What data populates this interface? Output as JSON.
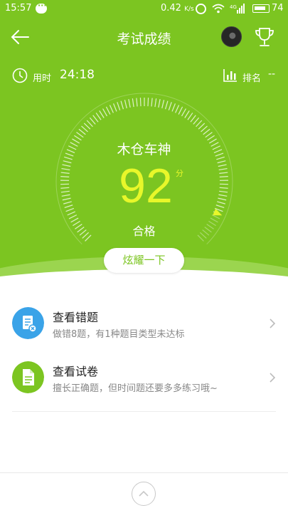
{
  "status_bar": {
    "time": "15:57",
    "network_speed": "0.42",
    "network_unit": "K/s",
    "battery": "74",
    "icons": [
      "message-icon",
      "alarm-icon",
      "wifi-icon",
      "signal-icon",
      "battery-icon"
    ]
  },
  "header": {
    "title": "考试成绩",
    "back_icon": "arrow-left-icon",
    "trophy_icon": "trophy-icon"
  },
  "info": {
    "time_used_label": "用时",
    "time_used_value": "24:18",
    "rank_label": "排名",
    "rank_value": "--"
  },
  "result": {
    "nickname": "木仓车神",
    "score": "92",
    "score_unit": "分",
    "status": "合格",
    "score_fraction": 0.92,
    "share_button": "炫耀一下"
  },
  "list": [
    {
      "title": "查看错题",
      "desc": "做错8题，有1种题目类型未达标",
      "icon": "wrong-questions-icon",
      "icon_color": "#3aa3e8"
    },
    {
      "title": "查看试卷",
      "desc": "擅长正确题，但时间题还要多多练习哦~",
      "icon": "exam-paper-icon",
      "icon_color": "#7cc521"
    }
  ],
  "colors": {
    "primary_green": "#7cc521",
    "score_yellow": "#e8f72a",
    "blue": "#3aa3e8"
  }
}
